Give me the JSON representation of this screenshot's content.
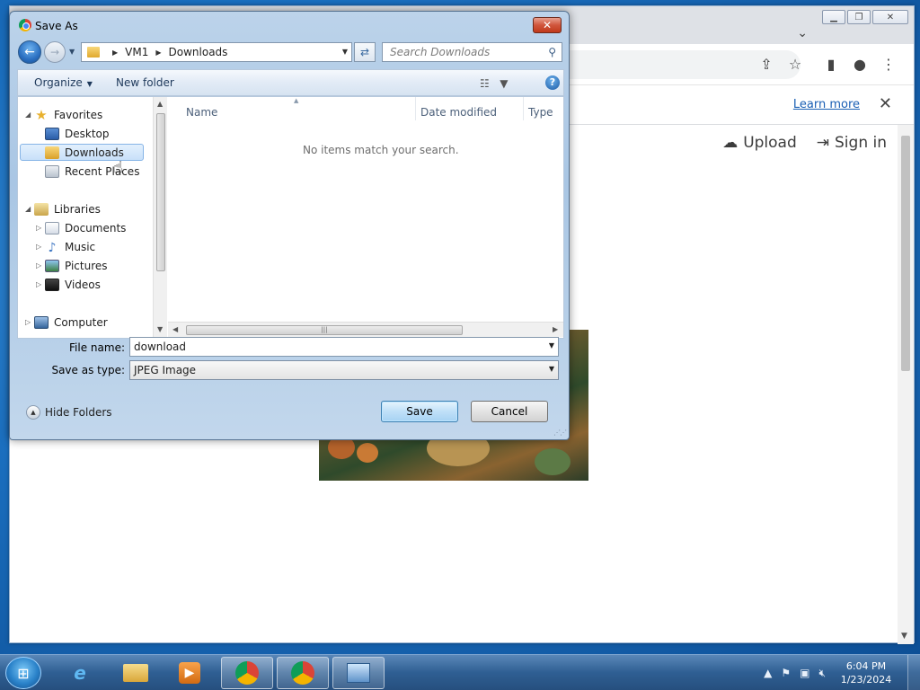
{
  "browser": {
    "learn_more": "Learn more",
    "upload_label": "Upload",
    "sign_in_label": "Sign in"
  },
  "dialog": {
    "title": "Save As",
    "address": {
      "root": "VM1",
      "folder": "Downloads"
    },
    "search_placeholder": "Search Downloads",
    "toolbar": {
      "organize": "Organize",
      "new_folder": "New folder"
    },
    "nav": {
      "favorites": "Favorites",
      "desktop": "Desktop",
      "downloads": "Downloads",
      "recent_places": "Recent Places",
      "libraries": "Libraries",
      "documents": "Documents",
      "music": "Music",
      "pictures": "Pictures",
      "videos": "Videos",
      "computer": "Computer"
    },
    "columns": {
      "name": "Name",
      "date_modified": "Date modified",
      "type": "Type"
    },
    "empty_message": "No items match your search.",
    "file_name_label": "File name:",
    "file_name_value": "download",
    "save_type_label": "Save as type:",
    "save_type_value": "JPEG Image",
    "hide_folders": "Hide Folders",
    "save_button": "Save",
    "cancel_button": "Cancel"
  },
  "taskbar": {
    "time": "6:04 PM",
    "date": "1/23/2024"
  }
}
